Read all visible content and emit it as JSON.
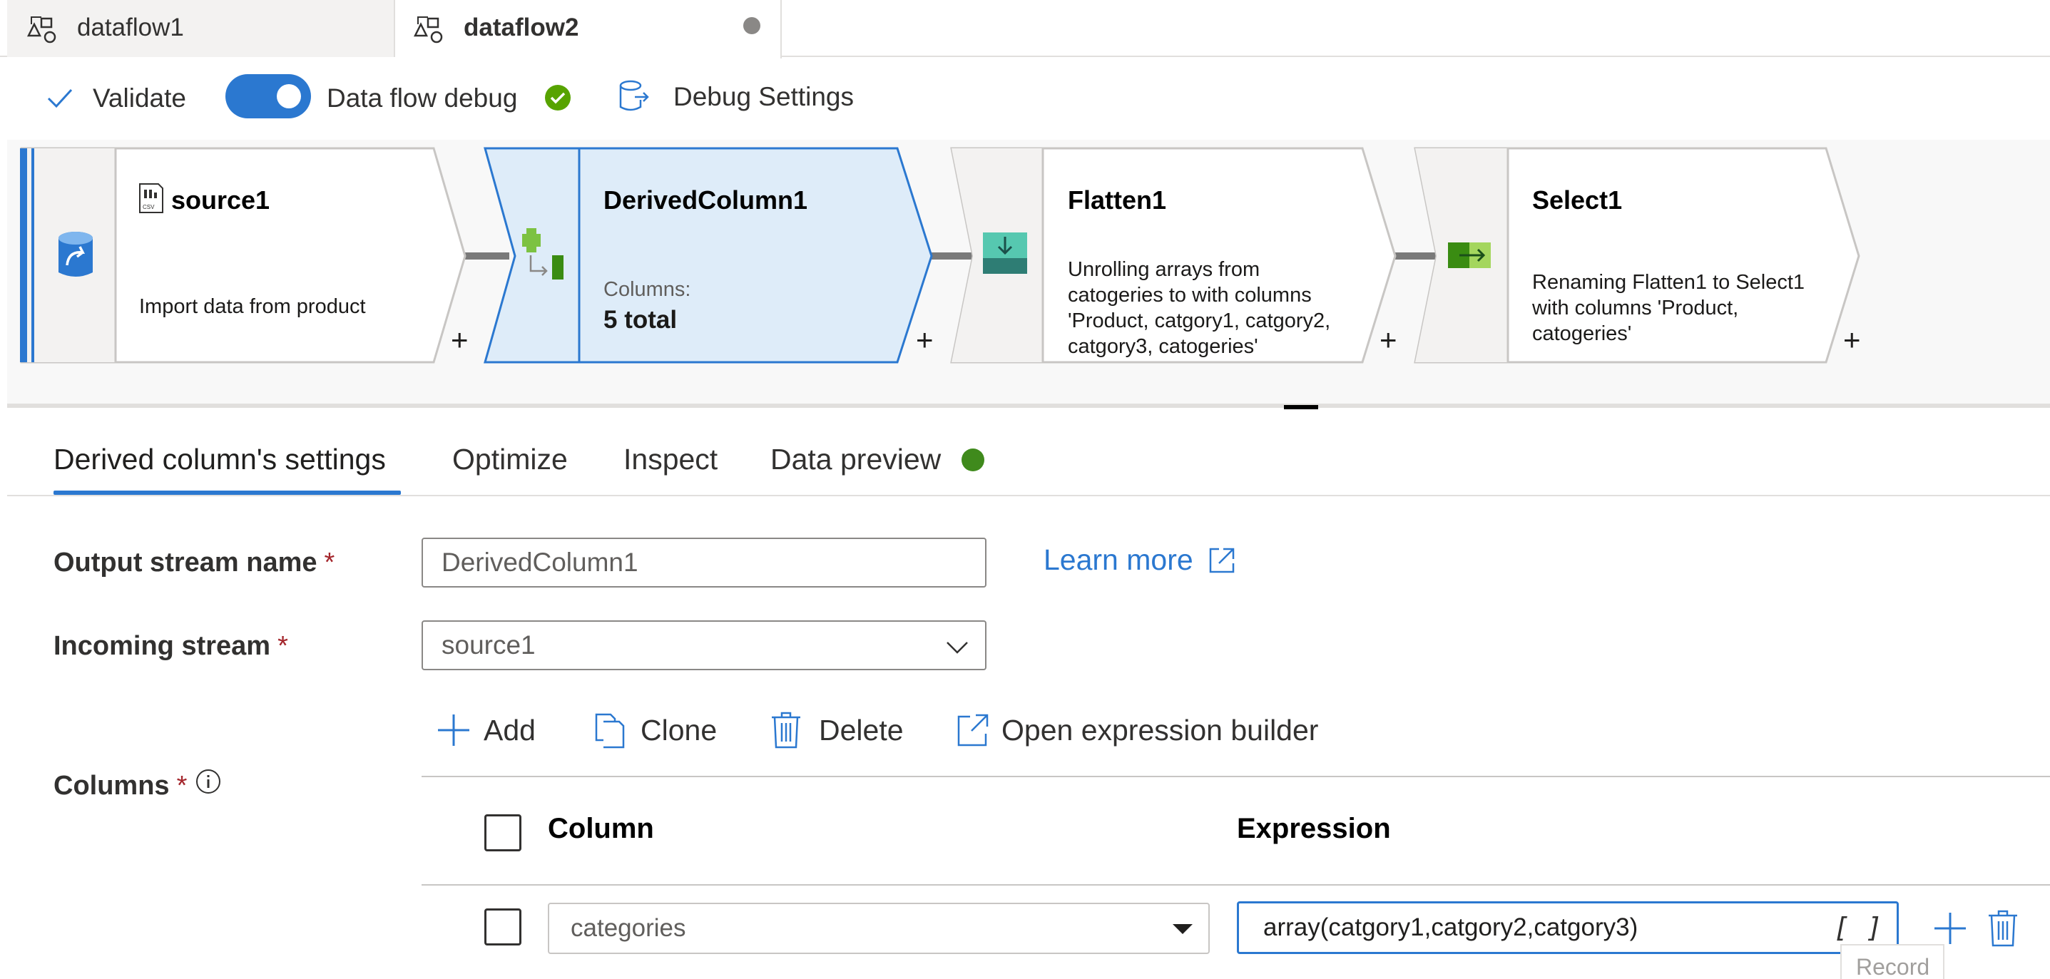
{
  "tabs": [
    {
      "label": "dataflow1",
      "active": false,
      "icon": "dataflow-icon"
    },
    {
      "label": "dataflow2",
      "active": true,
      "icon": "dataflow-icon",
      "unsaved": true
    }
  ],
  "toolbar": {
    "validate_label": "Validate",
    "debug_label": "Data flow debug",
    "debug_on": true,
    "debug_settings_label": "Debug Settings"
  },
  "nodes": [
    {
      "name": "source1",
      "description": "Import data from product",
      "icon": "source-csv-icon"
    },
    {
      "name": "DerivedColumn1",
      "columns_label": "Columns:",
      "columns_value": "5 total",
      "icon": "derived-column-icon",
      "selected": true
    },
    {
      "name": "Flatten1",
      "description": [
        "Unrolling arrays from",
        "catogeries to  with columns",
        "'Product, catgory1, catgory2,",
        "catgory3, catogeries'"
      ],
      "icon": "flatten-icon"
    },
    {
      "name": "Select1",
      "description": [
        "Renaming Flatten1 to Select1",
        "with columns 'Product,",
        "catogeries'"
      ],
      "icon": "select-icon"
    }
  ],
  "plus": "+",
  "settings_tabs": [
    {
      "label": "Derived column's settings",
      "active": true
    },
    {
      "label": "Optimize"
    },
    {
      "label": "Inspect"
    },
    {
      "label": "Data preview"
    }
  ],
  "form": {
    "output_label": "Output stream name",
    "output_value": "DerivedColumn1",
    "learn_more": "Learn more",
    "incoming_label": "Incoming stream",
    "incoming_value": "source1",
    "columns_label": "Columns",
    "required_mark": "*"
  },
  "actions": {
    "add": "Add",
    "clone": "Clone",
    "delete": "Delete",
    "open_builder": "Open expression builder"
  },
  "grid": {
    "header_column": "Column",
    "header_expression": "Expression",
    "rows": [
      {
        "column": "categories",
        "expression": "array(catgory1,catgory2,catgory3)",
        "type_badge": "[ ]"
      }
    ]
  },
  "tooltip": "Record",
  "colors": {
    "accent": "#2b78d0",
    "success": "#57a300"
  }
}
